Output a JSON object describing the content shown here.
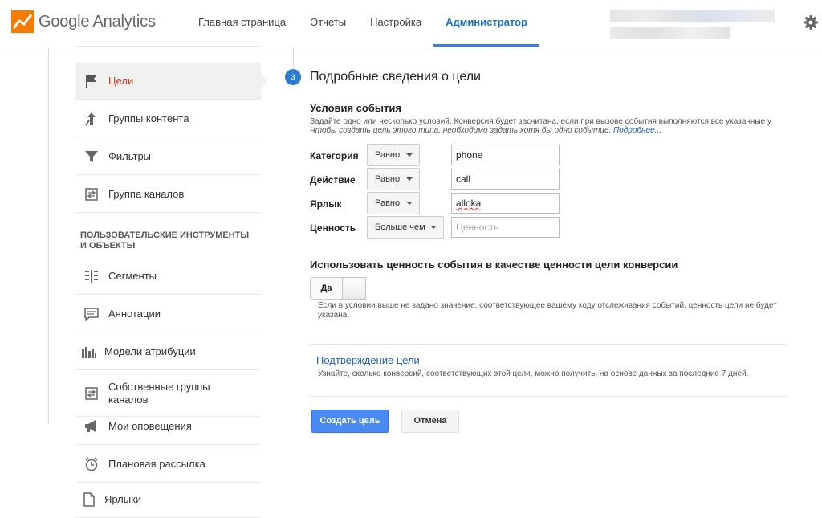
{
  "header": {
    "logo_text": "Google Analytics",
    "nav": [
      {
        "label": "Главная страница"
      },
      {
        "label": "Отчеты"
      },
      {
        "label": "Настройка"
      },
      {
        "label": "Администратор"
      }
    ],
    "active_nav": "Администратор"
  },
  "sidebar": {
    "items_top": [
      {
        "label": "Цели",
        "icon": "flag-icon",
        "selected": true
      },
      {
        "label": "Группы контента",
        "icon": "content-groups-icon"
      },
      {
        "label": "Фильтры",
        "icon": "filter-icon"
      },
      {
        "label": "Группа каналов",
        "icon": "channel-group-icon"
      }
    ],
    "section_heading": "ПОЛЬЗОВАТЕЛЬСКИЕ ИНСТРУМЕНТЫ И ОБЪЕКТЫ",
    "items_bottom": [
      {
        "label": "Сегменты",
        "icon": "segments-icon"
      },
      {
        "label": "Аннотации",
        "icon": "annotations-icon"
      },
      {
        "label": "Модели атрибуции",
        "icon": "attribution-icon"
      },
      {
        "label": "Собственные группы каналов",
        "icon": "custom-channel-icon"
      },
      {
        "label": "Мои оповещения",
        "icon": "megaphone-icon"
      },
      {
        "label": "Плановая рассылка",
        "icon": "alarm-clock-icon"
      },
      {
        "label": "Ярлыки",
        "icon": "document-icon"
      }
    ]
  },
  "goal": {
    "step_number": "3",
    "step_title": "Подробные сведения о цели",
    "conditions_title": "Условия события",
    "conditions_desc": "Задайте одно или несколько условий. Конверсия будет засчитана, если при вызове события выполняются все указанные у",
    "conditions_hint": "Чтобы создать цель этого типа, необходимо задать хотя бы одно событие.",
    "more_link": "Подробнее...",
    "rows": [
      {
        "label": "Категория",
        "operator": "Равно",
        "value": "phone",
        "placeholder": ""
      },
      {
        "label": "Действие",
        "operator": "Равно",
        "value": "call",
        "placeholder": ""
      },
      {
        "label": "Ярлык",
        "operator": "Равно",
        "value": "alloka",
        "placeholder": ""
      },
      {
        "label": "Ценность",
        "operator": "Больше чем",
        "value": "",
        "placeholder": "Ценность"
      }
    ],
    "use_value_title": "Использовать ценность события в качестве ценности цели конверсии",
    "toggle_label": "Да",
    "toggle_state": "on",
    "use_value_note": "Если в условии выше не задано значение, соответствующее вашему коду отслеживания событий, ценность цели не будет указана.",
    "verify_link": "Подтверждение цели",
    "verify_desc": "Узнайте, сколько конверсий, соответствующих этой цели, можно получить, на основе данных за последние 7 дней.",
    "create_button": "Создать цель",
    "cancel_button": "Отмена"
  },
  "colors": {
    "accent": "#4a8af4",
    "nav_active": "#1e72c7",
    "selected_item": "#d0391e",
    "logo_orange": "#f57c00"
  }
}
